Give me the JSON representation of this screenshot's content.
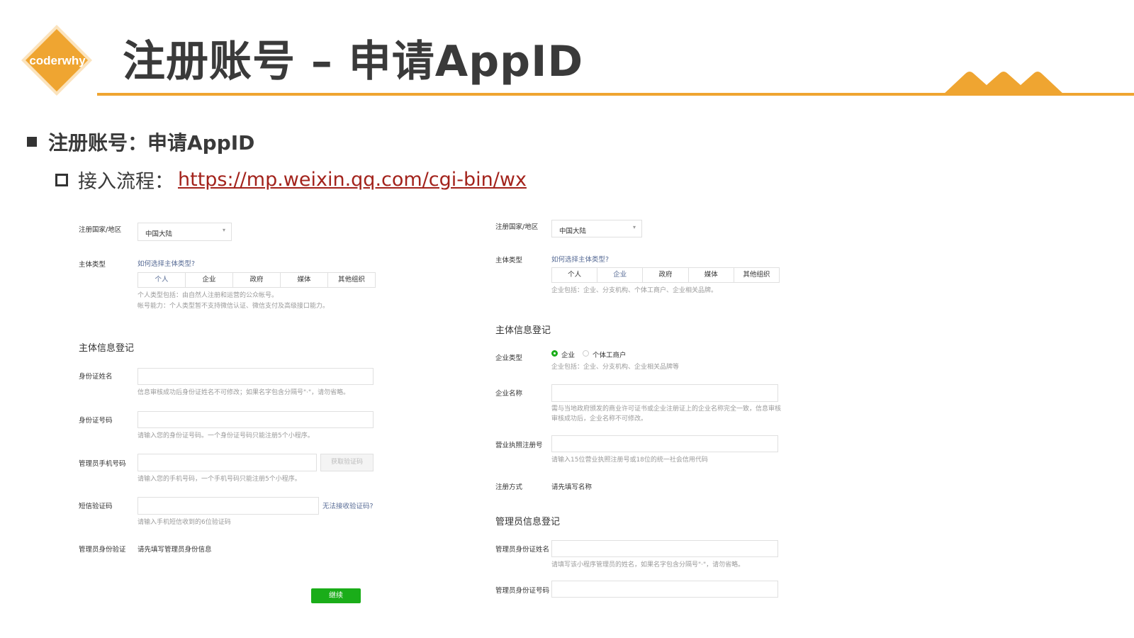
{
  "header": {
    "logo_text": "coderwhy",
    "title": "注册账号 – 申请AppID",
    "accent_color": "#efa531"
  },
  "bullets": {
    "main": "注册账号：申请AppID",
    "sub_label": "接入流程：",
    "sub_link": "https://mp.weixin.qq.com/cgi-bin/wx"
  },
  "form_left": {
    "region_label": "注册国家/地区",
    "region_value": "中国大陆",
    "type_label": "主体类型",
    "type_help_link": "如何选择主体类型?",
    "tabs": [
      "个人",
      "企业",
      "政府",
      "媒体",
      "其他组织"
    ],
    "type_hint_1": "个人类型包括：由自然人注册和运营的公众帐号。",
    "type_hint_2": "帐号能力：个人类型暂不支持微信认证、微信支付及高级接口能力。",
    "section_title": "主体信息登记",
    "id_name_label": "身份证姓名",
    "id_name_hint": "信息审核成功后身份证姓名不可修改；如果名字包含分隔号\"·\"，请勿省略。",
    "id_number_label": "身份证号码",
    "id_number_hint": "请输入您的身份证号码。一个身份证号码只能注册5个小程序。",
    "phone_label": "管理员手机号码",
    "get_code_button": "获取验证码",
    "phone_hint": "请输入您的手机号码，一个手机号码只能注册5个小程序。",
    "sms_label": "短信验证码",
    "sms_help_link": "无法接收验证码?",
    "sms_hint": "请输入手机短信收到的6位验证码",
    "admin_verify_label": "管理员身份验证",
    "admin_verify_value": "请先填写管理员身份信息",
    "continue_button": "继续"
  },
  "form_right": {
    "region_label": "注册国家/地区",
    "region_value": "中国大陆",
    "type_label": "主体类型",
    "type_help_link": "如何选择主体类型?",
    "tabs": [
      "个人",
      "企业",
      "政府",
      "媒体",
      "其他组织"
    ],
    "type_hint": "企业包括：企业、分支机构、个体工商户、企业相关品牌。",
    "section_title": "主体信息登记",
    "company_type_label": "企业类型",
    "radio_company": "企业",
    "radio_individual": "个体工商户",
    "company_type_hint": "企业包括：企业、分支机构、企业相关品牌等",
    "company_name_label": "企业名称",
    "company_name_hint_1": "需与当地政府颁发的商业许可证书或企业注册证上的企业名称完全一致，信息审核",
    "company_name_hint_2": "审核成功后，企业名称不可修改。",
    "license_label": "营业执照注册号",
    "license_hint": "请输入15位营业执照注册号或18位的统一社会信用代码",
    "reg_method_label": "注册方式",
    "reg_method_value": "请先填写名称",
    "admin_section_title": "管理员信息登记",
    "admin_name_label": "管理员身份证姓名",
    "admin_name_hint": "请填写该小程序管理员的姓名，如果名字包含分隔号\"·\"，请勿省略。",
    "admin_id_label": "管理员身份证号码"
  }
}
